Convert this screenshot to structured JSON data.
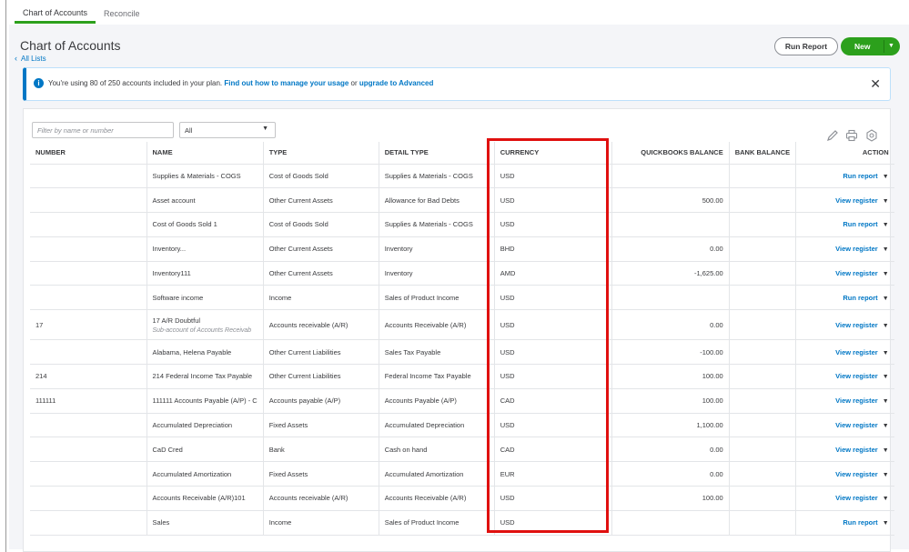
{
  "tabs": [
    {
      "label": "Chart of Accounts"
    },
    {
      "label": "Reconcile"
    }
  ],
  "page": {
    "title": "Chart of Accounts",
    "back_link": "All Lists"
  },
  "buttons": {
    "run_report": "Run Report",
    "new": "New"
  },
  "banner": {
    "message": "You're using 80 of 250 accounts included in your plan.",
    "link1": "Find out how to manage your usage",
    "connector": "or",
    "link2": "upgrade to Advanced"
  },
  "filter": {
    "placeholder": "Filter by name or number",
    "select_value": "All"
  },
  "icons": [
    "edit-icon",
    "print-icon",
    "settings-icon"
  ],
  "columns": {
    "number": "NUMBER",
    "name": "NAME",
    "type": "TYPE",
    "detail_type": "DETAIL TYPE",
    "currency": "CURRENCY",
    "qb_balance": "QUICKBOOKS BALANCE",
    "bank_balance": "BANK BALANCE",
    "action": "ACTION"
  },
  "rows": [
    {
      "number": "",
      "name": "Supplies & Materials - COGS",
      "sub": "",
      "type": "Cost of Goods Sold",
      "detail": "Supplies & Materials - COGS",
      "currency": "USD",
      "qb": "",
      "bank": "",
      "action": "Run report"
    },
    {
      "number": "",
      "name": "Asset account",
      "sub": "",
      "type": "Other Current Assets",
      "detail": "Allowance for Bad Debts",
      "currency": "USD",
      "qb": "500.00",
      "bank": "",
      "action": "View register"
    },
    {
      "number": "",
      "name": "Cost of Goods Sold 1",
      "sub": "",
      "type": "Cost of Goods Sold",
      "detail": "Supplies & Materials - COGS",
      "currency": "USD",
      "qb": "",
      "bank": "",
      "action": "Run report"
    },
    {
      "number": "",
      "name": "Inventory...",
      "sub": "",
      "type": "Other Current Assets",
      "detail": "Inventory",
      "currency": "BHD",
      "qb": "0.00",
      "bank": "",
      "action": "View register"
    },
    {
      "number": "",
      "name": "Inventory111",
      "sub": "",
      "type": "Other Current Assets",
      "detail": "Inventory",
      "currency": "AMD",
      "qb": "-1,625.00",
      "bank": "",
      "action": "View register"
    },
    {
      "number": "",
      "name": "Software income",
      "sub": "",
      "type": "Income",
      "detail": "Sales of Product Income",
      "currency": "USD",
      "qb": "",
      "bank": "",
      "action": "Run report"
    },
    {
      "number": "17",
      "name": "17 A/R Doubtful",
      "sub": "Sub-account of Accounts Receivab",
      "type": "Accounts receivable (A/R)",
      "detail": "Accounts Receivable (A/R)",
      "currency": "USD",
      "qb": "0.00",
      "bank": "",
      "action": "View register"
    },
    {
      "number": "",
      "name": "Alabama, Helena Payable",
      "sub": "",
      "type": "Other Current Liabilities",
      "detail": "Sales Tax Payable",
      "currency": "USD",
      "qb": "-100.00",
      "bank": "",
      "action": "View register"
    },
    {
      "number": "214",
      "name": "214 Federal Income Tax Payable",
      "sub": "",
      "type": "Other Current Liabilities",
      "detail": "Federal Income Tax Payable",
      "currency": "USD",
      "qb": "100.00",
      "bank": "",
      "action": "View register"
    },
    {
      "number": "111111",
      "name": "111111 Accounts Payable (A/P) - C",
      "sub": "",
      "type": "Accounts payable (A/P)",
      "detail": "Accounts Payable (A/P)",
      "currency": "CAD",
      "qb": "100.00",
      "bank": "",
      "action": "View register"
    },
    {
      "number": "",
      "name": "Accumulated Depreciation",
      "sub": "",
      "type": "Fixed Assets",
      "detail": "Accumulated Depreciation",
      "currency": "USD",
      "qb": "1,100.00",
      "bank": "",
      "action": "View register"
    },
    {
      "number": "",
      "name": "CaD Cred",
      "sub": "",
      "type": "Bank",
      "detail": "Cash on hand",
      "currency": "CAD",
      "qb": "0.00",
      "bank": "",
      "action": "View register"
    },
    {
      "number": "",
      "name": "Accumulated Amortization",
      "sub": "",
      "type": "Fixed Assets",
      "detail": "Accumulated Amortization",
      "currency": "EUR",
      "qb": "0.00",
      "bank": "",
      "action": "View register"
    },
    {
      "number": "",
      "name": "Accounts Receivable (A/R)101",
      "sub": "",
      "type": "Accounts receivable (A/R)",
      "detail": "Accounts Receivable (A/R)",
      "currency": "USD",
      "qb": "100.00",
      "bank": "",
      "action": "View register"
    },
    {
      "number": "",
      "name": "Sales",
      "sub": "",
      "type": "Income",
      "detail": "Sales of Product Income",
      "currency": "USD",
      "qb": "",
      "bank": "",
      "action": "Run report"
    }
  ],
  "colors": {
    "accent_green": "#2ca01c",
    "link_blue": "#0077c5",
    "highlight_red": "#e0100f"
  }
}
